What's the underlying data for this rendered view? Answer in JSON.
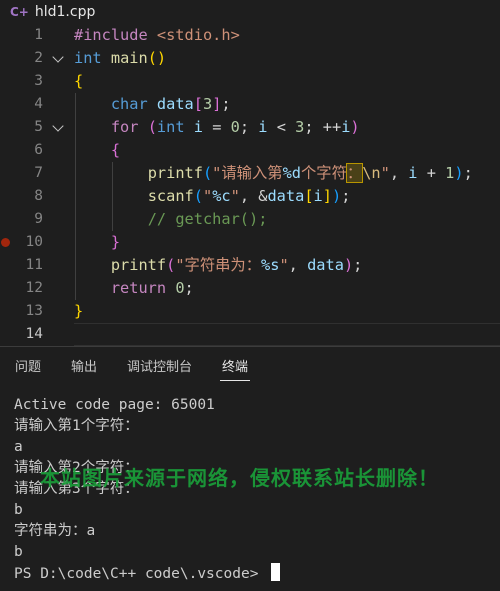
{
  "tab": {
    "icon": "C+",
    "filename": "hld1.cpp"
  },
  "editor": {
    "line_numbers": [
      "1",
      "2",
      "3",
      "4",
      "5",
      "6",
      "7",
      "8",
      "9",
      "10",
      "11",
      "12",
      "13",
      "14"
    ],
    "lines": [
      {
        "ln": "1",
        "tokens": [
          [
            "t-pre",
            "#include "
          ],
          [
            "t-inc",
            "<stdio.h>"
          ]
        ]
      },
      {
        "ln": "2",
        "tokens": [
          [
            "t-kw",
            "int"
          ],
          [
            "t-op",
            " "
          ],
          [
            "t-fn",
            "main"
          ],
          [
            "t-p1",
            "()"
          ]
        ]
      },
      {
        "ln": "3",
        "tokens": [
          [
            "t-p1",
            "{"
          ]
        ]
      },
      {
        "ln": "4",
        "tokens": [
          [
            "t-op",
            "    "
          ],
          [
            "t-kw",
            "char"
          ],
          [
            "t-op",
            " "
          ],
          [
            "t-var",
            "data"
          ],
          [
            "t-p2",
            "["
          ],
          [
            "t-num",
            "3"
          ],
          [
            "t-p2",
            "]"
          ],
          [
            "t-op",
            ";"
          ]
        ]
      },
      {
        "ln": "5",
        "tokens": [
          [
            "t-op",
            "    "
          ],
          [
            "t-ctl",
            "for"
          ],
          [
            "t-op",
            " "
          ],
          [
            "t-p2",
            "("
          ],
          [
            "t-kw",
            "int"
          ],
          [
            "t-op",
            " "
          ],
          [
            "t-var",
            "i"
          ],
          [
            "t-op",
            " = "
          ],
          [
            "t-num",
            "0"
          ],
          [
            "t-op",
            "; "
          ],
          [
            "t-var",
            "i"
          ],
          [
            "t-op",
            " < "
          ],
          [
            "t-num",
            "3"
          ],
          [
            "t-op",
            "; ++"
          ],
          [
            "t-var",
            "i"
          ],
          [
            "t-p2",
            ")"
          ]
        ]
      },
      {
        "ln": "6",
        "tokens": [
          [
            "t-op",
            "    "
          ],
          [
            "t-p2",
            "{"
          ]
        ]
      },
      {
        "ln": "7",
        "tokens": [
          [
            "t-op",
            "        "
          ],
          [
            "t-fn",
            "printf"
          ],
          [
            "t-p3",
            "("
          ],
          [
            "t-str",
            "\"请输入第"
          ],
          [
            "t-var",
            "%d"
          ],
          [
            "t-str",
            "个字符"
          ],
          [
            "hl t-str",
            "："
          ],
          [
            "t-esc",
            "\\n"
          ],
          [
            "t-str",
            "\""
          ],
          [
            "t-op",
            ", "
          ],
          [
            "t-var",
            "i"
          ],
          [
            "t-op",
            " + "
          ],
          [
            "t-num",
            "1"
          ],
          [
            "t-p3",
            ")"
          ],
          [
            "t-op",
            ";"
          ]
        ]
      },
      {
        "ln": "8",
        "tokens": [
          [
            "t-op",
            "        "
          ],
          [
            "t-fn",
            "scanf"
          ],
          [
            "t-p3",
            "("
          ],
          [
            "t-str",
            "\""
          ],
          [
            "t-var",
            "%c"
          ],
          [
            "t-str",
            "\""
          ],
          [
            "t-op",
            ", &"
          ],
          [
            "t-var",
            "data"
          ],
          [
            "t-p1",
            "["
          ],
          [
            "t-var",
            "i"
          ],
          [
            "t-p1",
            "]"
          ],
          [
            "t-p3",
            ")"
          ],
          [
            "t-op",
            ";"
          ]
        ]
      },
      {
        "ln": "9",
        "tokens": [
          [
            "t-op",
            "        "
          ],
          [
            "t-com",
            "// getchar();"
          ]
        ]
      },
      {
        "ln": "10",
        "tokens": [
          [
            "t-op",
            "    "
          ],
          [
            "t-p2",
            "}"
          ]
        ]
      },
      {
        "ln": "11",
        "tokens": [
          [
            "t-op",
            "    "
          ],
          [
            "t-fn",
            "printf"
          ],
          [
            "t-p2",
            "("
          ],
          [
            "t-str",
            "\"字符串为："
          ],
          [
            "t-var",
            "%s"
          ],
          [
            "t-str",
            "\""
          ],
          [
            "t-op",
            ", "
          ],
          [
            "t-var",
            "data"
          ],
          [
            "t-p2",
            ")"
          ],
          [
            "t-op",
            ";"
          ]
        ]
      },
      {
        "ln": "12",
        "tokens": [
          [
            "t-op",
            "    "
          ],
          [
            "t-ctl",
            "return"
          ],
          [
            "t-op",
            " "
          ],
          [
            "t-num",
            "0"
          ],
          [
            "t-op",
            ";"
          ]
        ]
      },
      {
        "ln": "13",
        "tokens": [
          [
            "t-p1",
            "}"
          ]
        ]
      },
      {
        "ln": "14",
        "tokens": []
      }
    ]
  },
  "panel": {
    "tabs": [
      "问题",
      "输出",
      "调试控制台",
      "终端"
    ],
    "active_tab": "终端",
    "terminal_lines": [
      "Active code page: 65001",
      "请输入第1个字符：",
      "a",
      "请输入第2个字符：",
      "请输入第3个字符：",
      "b",
      "字符串为：a",
      "b",
      "PS D:\\code\\C++ code\\.vscode> "
    ]
  },
  "watermark": "本站图片来源于网络，侵权联系站长删除！",
  "colors": {
    "background": "#1e1e1e",
    "keyword": "#569cd6",
    "string": "#ce9178",
    "function": "#dcdcaa",
    "comment": "#6a9955"
  }
}
